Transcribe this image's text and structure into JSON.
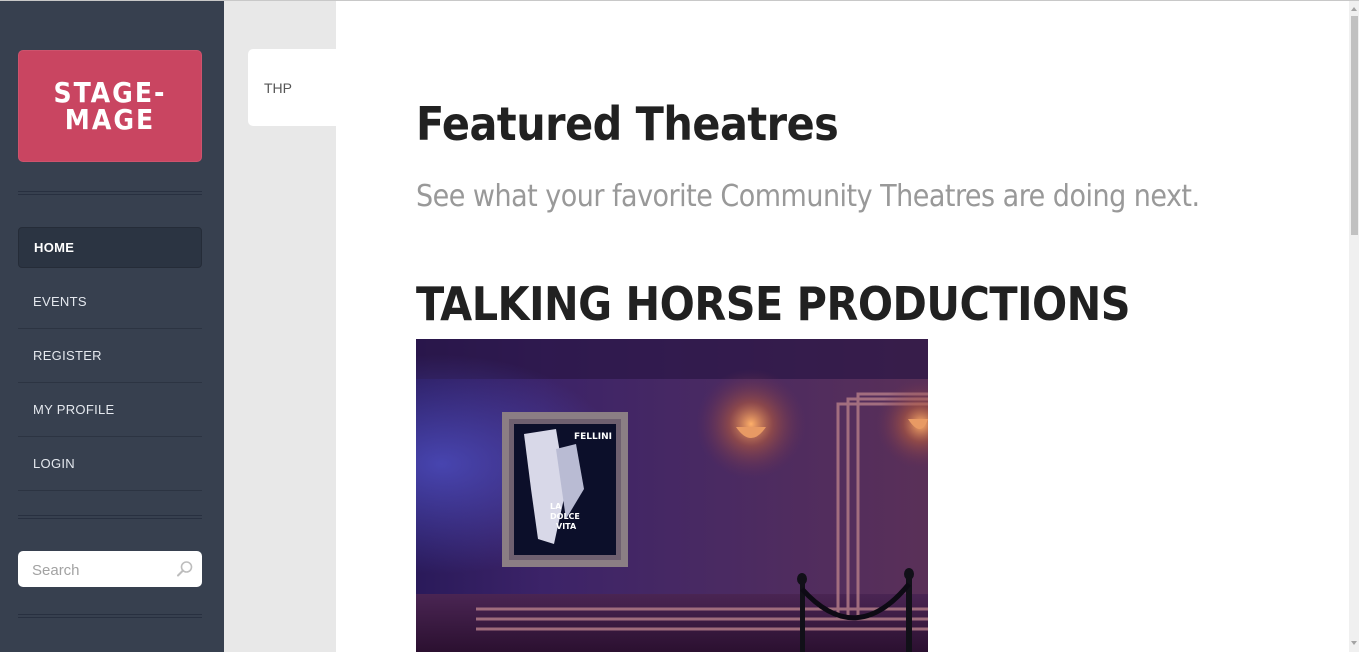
{
  "sidebar": {
    "logo_text": "STAGE-MAGE",
    "nav": [
      {
        "label": "HOME",
        "active": true
      },
      {
        "label": "EVENTS",
        "active": false
      },
      {
        "label": "REGISTER",
        "active": false
      },
      {
        "label": "MY PROFILE",
        "active": false
      },
      {
        "label": "LOGIN",
        "active": false
      }
    ],
    "search_placeholder": "Search"
  },
  "tab": {
    "label": "THP"
  },
  "main": {
    "title": "Featured Theatres",
    "subtitle": "See what your favorite Community Theatres are doing next.",
    "theatre_name": "TALKING HORSE PRODUCTIONS",
    "poster": {
      "line1": "FELLINI",
      "line2": "LA",
      "line3": "DOLCE",
      "line4": "VITA"
    }
  },
  "colors": {
    "sidebar_bg": "#37404f",
    "logo_bg": "#c94561",
    "accent_text": "#212121",
    "muted_text": "#999999"
  },
  "icons": {
    "search": "search-icon"
  }
}
